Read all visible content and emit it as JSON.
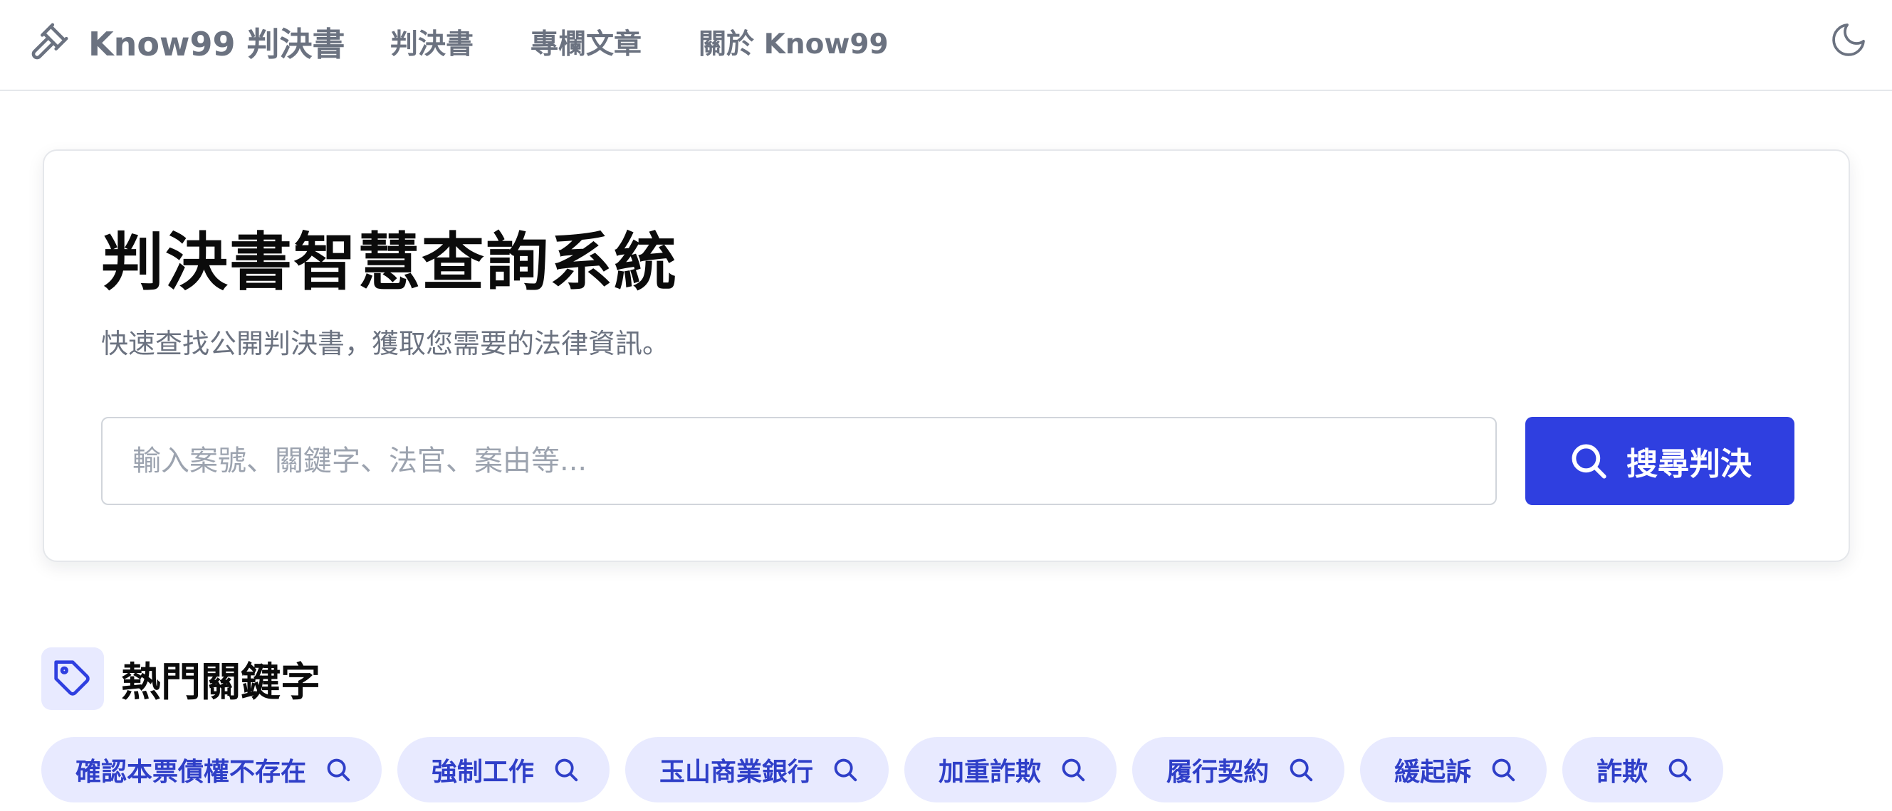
{
  "header": {
    "brand": "Know99 判決書",
    "nav": [
      "判決書",
      "專欄文章",
      "關於 Know99"
    ]
  },
  "hero": {
    "title": "判決書智慧查詢系統",
    "subtitle": "快速查找公開判決書，獲取您需要的法律資訊。",
    "search": {
      "placeholder": "輸入案號、關鍵字、法官、案由等...",
      "value": "",
      "button_label": "搜尋判決"
    }
  },
  "hot_keywords": {
    "title": "熱門關鍵字",
    "items": [
      "確認本票債權不存在",
      "強制工作",
      "玉山商業銀行",
      "加重詐欺",
      "履行契約",
      "緩起訴",
      "詐欺"
    ]
  },
  "icons": {
    "brand": "gavel-icon",
    "theme_toggle": "moon-icon",
    "search_button": "search-icon",
    "section": "tag-icon",
    "chip": "search-icon"
  },
  "colors": {
    "accent": "#2f3fe0",
    "chip_bg": "#e8eaff",
    "chip_text": "#2f3fc8",
    "muted_text": "#6b7280"
  }
}
